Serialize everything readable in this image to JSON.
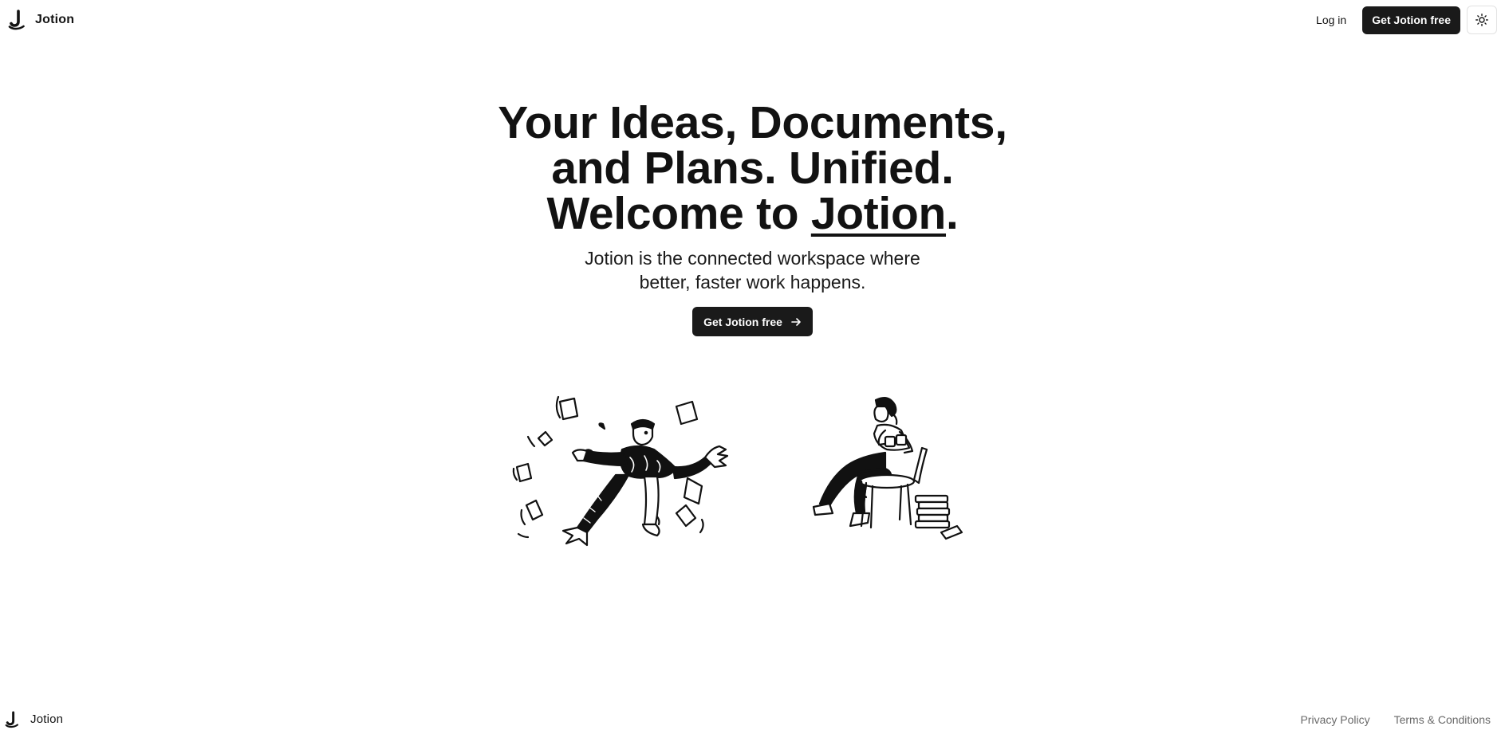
{
  "brand": {
    "name": "Jotion",
    "logo_icon": "jotion-logo-icon"
  },
  "header": {
    "login_label": "Log in",
    "cta_label": "Get Jotion free",
    "theme_toggle_icon": "sun-icon"
  },
  "hero": {
    "title_line1": "Your Ideas, Documents,",
    "title_line2": "and Plans. Unified.",
    "title_line3_prefix": "Welcome to ",
    "title_line3_brand": "Jotion",
    "title_line3_suffix": ".",
    "subtitle_line1": "Jotion is the connected workspace where",
    "subtitle_line2": "better, faster work happens.",
    "cta_label": "Get Jotion free",
    "cta_icon": "arrow-right-icon"
  },
  "illustrations": {
    "left": "person-juggling-documents-illustration",
    "right": "person-reading-on-chair-illustration"
  },
  "footer": {
    "brand_name": "Jotion",
    "privacy_label": "Privacy Policy",
    "terms_label": "Terms & Conditions"
  },
  "colors": {
    "primary_button": "#1a1a1a",
    "text": "#141414",
    "muted_text": "#6a6a6a",
    "background": "#ffffff"
  }
}
